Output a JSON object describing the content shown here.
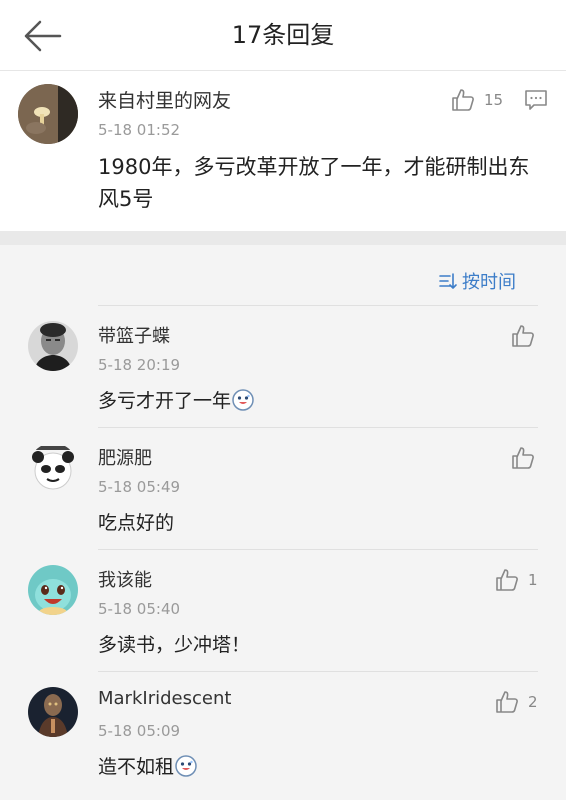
{
  "header": {
    "title": "17条回复"
  },
  "main_post": {
    "username": "来自村里的网友",
    "time": "5-18 01:52",
    "likes": "15",
    "text": "1980年，多亏改革开放了一年，才能研制出东风5号"
  },
  "sort": {
    "label": "按时间"
  },
  "replies": [
    {
      "username": "带篮子蝶",
      "time": "5-18 20:19",
      "text": "多亏才开了一年",
      "likes": ""
    },
    {
      "username": "肥源肥",
      "time": "5-18 05:49",
      "text": "吃点好的",
      "likes": ""
    },
    {
      "username": "我该能",
      "time": "5-18 05:40",
      "text": "多读书，少冲塔！",
      "likes": "1"
    },
    {
      "username": "MarkIridescent",
      "time": "5-18 05:09",
      "text": "造不如租",
      "likes": "2"
    }
  ],
  "colors": {
    "accent": "#3d7dc8",
    "muted": "#9a9a9a"
  }
}
